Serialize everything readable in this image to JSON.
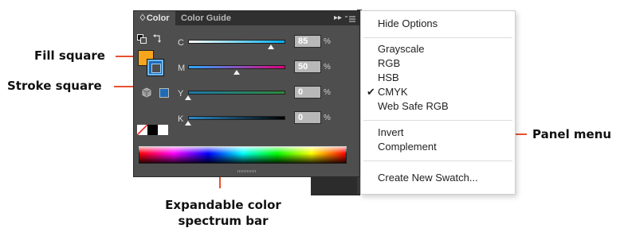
{
  "callouts": {
    "fill_square": "Fill square",
    "stroke_square": "Stroke square",
    "panel_menu": "Panel menu",
    "spectrum_line1": "Expandable color",
    "spectrum_line2": "spectrum bar"
  },
  "panel": {
    "tabs": [
      {
        "label": "♢Color",
        "active": true
      },
      {
        "label": "Color Guide",
        "active": false
      }
    ],
    "expand_glyph": "▸▸",
    "channels": [
      {
        "label": "C",
        "value": "85",
        "unit": "%",
        "level": 0.85,
        "gradient": [
          "#ffffff",
          "#00aeef"
        ]
      },
      {
        "label": "M",
        "value": "50",
        "unit": "%",
        "level": 0.5,
        "gradient": [
          "#2aa9ff",
          "#e0007a"
        ]
      },
      {
        "label": "Y",
        "value": "0",
        "unit": "%",
        "level": 0.0,
        "gradient": [
          "#1f78a8",
          "#2f8a3a"
        ]
      },
      {
        "label": "K",
        "value": "0",
        "unit": "%",
        "level": 0.0,
        "gradient": [
          "#2a8ac8",
          "#000000"
        ]
      }
    ],
    "fill_color": "#f7a51c",
    "stroke_color": "#1f6bb5"
  },
  "menu": {
    "items": [
      {
        "label": "Hide Options",
        "checked": false
      },
      {
        "label": "Grayscale",
        "checked": false
      },
      {
        "label": "RGB",
        "checked": false
      },
      {
        "label": "HSB",
        "checked": false
      },
      {
        "label": "CMYK",
        "checked": true
      },
      {
        "label": "Web Safe RGB",
        "checked": false
      },
      {
        "label": "Invert",
        "checked": false
      },
      {
        "label": "Complement",
        "checked": false
      },
      {
        "label": "Create New Swatch...",
        "checked": false
      }
    ],
    "check_glyph": "✔"
  },
  "colors": {
    "accent": "#e8512f",
    "panel_bg": "#4e4e4e"
  }
}
